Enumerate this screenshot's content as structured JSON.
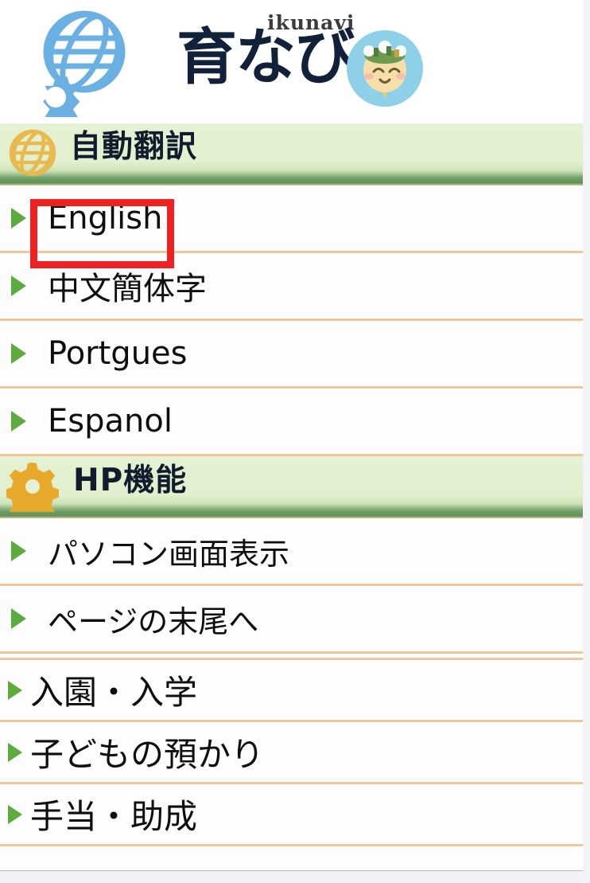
{
  "header": {
    "left_icon": "globe-gear-icon",
    "logo": {
      "romaji": "ikunavi",
      "kanji": "育なび",
      "badge_icon": "baby-face-icon"
    }
  },
  "sections": [
    {
      "id": "auto-translate",
      "icon": "globe-icon",
      "title": "自動翻訳",
      "items": [
        {
          "label": "English",
          "bullet": "triangle-right-icon",
          "highlighted": true
        },
        {
          "label": "中文簡体字",
          "bullet": "triangle-right-icon",
          "highlighted": false
        },
        {
          "label": "Portgues",
          "bullet": "triangle-right-icon",
          "highlighted": false
        },
        {
          "label": "Espanol",
          "bullet": "triangle-right-icon",
          "highlighted": false
        }
      ]
    },
    {
      "id": "hp-function",
      "icon": "gear-icon",
      "title": "HP機能",
      "items": [
        {
          "label": "パソコン画面表示",
          "bullet": "triangle-right-icon"
        },
        {
          "label": "ページの末尾へ",
          "bullet": "triangle-right-icon"
        }
      ]
    }
  ],
  "categories": [
    {
      "label": "入園・入学",
      "bullet": "triangle-right-icon"
    },
    {
      "label": "子どもの預かり",
      "bullet": "triangle-right-icon"
    },
    {
      "label": "手当・助成",
      "bullet": "triangle-right-icon"
    }
  ],
  "colors": {
    "bullet_green": "#5cab3c",
    "separator_tan": "#eec89a",
    "section_bg_light": "#e2f0cf",
    "section_bar_green": "#6f9f67",
    "section_icon_gold": "#e8a92a",
    "header_icon_blue": "#6bb0e2",
    "annotation_red": "#ef2020",
    "title_text": "#121b2e"
  },
  "annotation": {
    "type": "highlight-box",
    "target": "English"
  }
}
